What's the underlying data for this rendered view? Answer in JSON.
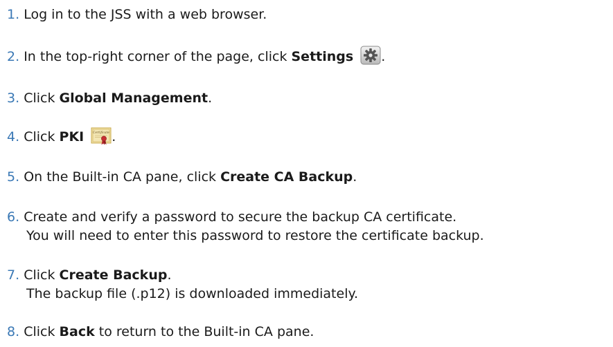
{
  "steps": [
    {
      "num": "1.",
      "parts": [
        "Log in to the JSS with a web browser."
      ]
    },
    {
      "num": "2.",
      "pre": "In the top-right corner of the page, click ",
      "bold": "Settings",
      "post": "."
    },
    {
      "num": "3.",
      "pre": "Click ",
      "bold": "Global Management",
      "post": "."
    },
    {
      "num": "4.",
      "pre": "Click ",
      "bold": "PKI",
      "post": "."
    },
    {
      "num": "5.",
      "pre": "On the Built-in CA pane, click ",
      "bold": "Create CA Backup",
      "post": "."
    },
    {
      "num": "6.",
      "line1": "Create and verify a password to secure the backup CA certificate.",
      "line2": "You will need to enter this password to restore the certificate backup."
    },
    {
      "num": "7.",
      "pre": "Click ",
      "bold": "Create Backup",
      "post": ".",
      "line2": "The backup file (.p12) is downloaded immediately."
    },
    {
      "num": "8.",
      "pre": "Click ",
      "bold": "Back",
      "post": " to return to the Built-in CA pane."
    }
  ],
  "icons": {
    "settings": "gear-icon",
    "pki": "certificate-icon"
  },
  "certificate_icon_text": "Certificate"
}
